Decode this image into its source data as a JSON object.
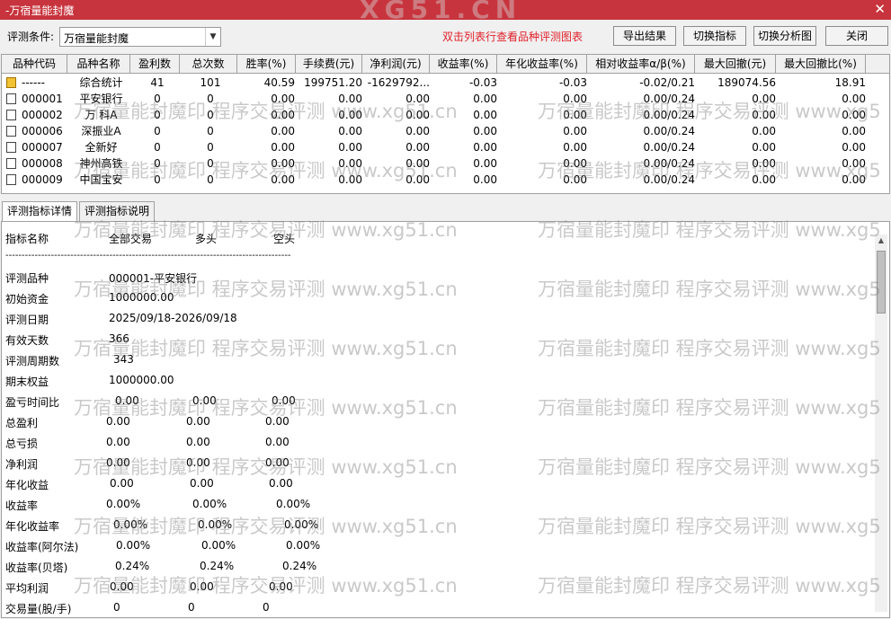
{
  "window": {
    "title": "-万宿量能封魔",
    "close_glyph": "✕"
  },
  "toolbar": {
    "condition_label": "评测条件:",
    "condition_value": "万宿量能封魔",
    "hint": "双击列表行查看品种评测图表",
    "buttons": [
      "导出结果",
      "切换指标",
      "切换分析图",
      "关闭"
    ]
  },
  "grid": {
    "columns": [
      "品种代码",
      "品种名称",
      "盈利数",
      "总次数",
      "胜率(%)",
      "手续费(元)",
      "净利润(元)",
      "收益率(%)",
      "年化收益率(%)",
      "相对收益率α/β(%)",
      "最大回撤(元)",
      "最大回撤比(%)"
    ],
    "rows": [
      [
        "------",
        "综合统计",
        "41",
        "101",
        "40.59",
        "199751.20",
        "-1629792...",
        "-0.03",
        "-0.03",
        "-0.02/0.21",
        "189074.56",
        "18.91"
      ],
      [
        "000001",
        "平安银行",
        "0",
        "0",
        "0.00",
        "0.00",
        "0.00",
        "0.00",
        "0.00",
        "0.00/0.24",
        "0.00",
        "0.00"
      ],
      [
        "000002",
        "万 科A",
        "0",
        "0",
        "0.00",
        "0.00",
        "0.00",
        "0.00",
        "0.00",
        "0.00/0.24",
        "0.00",
        "0.00"
      ],
      [
        "000006",
        "深振业A",
        "0",
        "0",
        "0.00",
        "0.00",
        "0.00",
        "0.00",
        "0.00",
        "0.00/0.24",
        "0.00",
        "0.00"
      ],
      [
        "000007",
        "全新好",
        "0",
        "0",
        "0.00",
        "0.00",
        "0.00",
        "0.00",
        "0.00",
        "0.00/0.24",
        "0.00",
        "0.00"
      ],
      [
        "000008",
        "神州高铁",
        "0",
        "0",
        "0.00",
        "0.00",
        "0.00",
        "0.00",
        "0.00",
        "0.00/0.24",
        "0.00",
        "0.00"
      ],
      [
        "000009",
        "中国宝安",
        "0",
        "0",
        "0.00",
        "0.00",
        "0.00",
        "0.00",
        "0.00",
        "0.00/0.24",
        "0.00",
        "0.00"
      ]
    ]
  },
  "tabs": [
    "评测指标详情",
    "评测指标说明"
  ],
  "detail": {
    "header": [
      "指标名称",
      "全部交易",
      "多头",
      "空头"
    ],
    "separator": "----------------------------------------------------------------------------------------",
    "info": [
      [
        "评测品种",
        "000001-平安银行"
      ],
      [
        "初始资金",
        "1000000.00"
      ],
      [
        "评测日期",
        "2025/09/18-2026/09/18"
      ],
      [
        "有效天数",
        "366"
      ],
      [
        "评测周期数",
        "343"
      ],
      [
        "期末权益",
        "1000000.00"
      ]
    ],
    "metrics": [
      [
        "盈亏时间比",
        "0.00",
        "0.00",
        "0.00"
      ],
      [
        "总盈利",
        "0.00",
        "0.00",
        "0.00"
      ],
      [
        "总亏损",
        "0.00",
        "0.00",
        "0.00"
      ],
      [
        "净利润",
        "0.00",
        "0.00",
        "0.00"
      ],
      [
        "年化收益",
        "0.00",
        "0.00",
        "0.00"
      ],
      [
        "收益率",
        "0.00%",
        "0.00%",
        "0.00%"
      ],
      [
        "年化收益率",
        "0.00%",
        "0.00%",
        "0.00%"
      ],
      [
        "收益率(阿尔法)",
        "0.00%",
        "0.00%",
        "0.00%"
      ],
      [
        "收益率(贝塔)",
        "0.24%",
        "0.24%",
        "0.24%"
      ],
      [
        "平均利润",
        "0.00",
        "0.00",
        "0.00"
      ],
      [
        "交易量(股/手)",
        "0",
        "0",
        "0"
      ]
    ]
  },
  "watermark": {
    "text": "万宿量能封魔印 程序交易评测 www.xg51.cn",
    "text_tail": "万宿量能封魔印 程序交易评测 www.xg5",
    "top_text": "XG51.CN"
  },
  "colors": {
    "titlebar": "#c8343d",
    "hint": "#e0202a"
  }
}
